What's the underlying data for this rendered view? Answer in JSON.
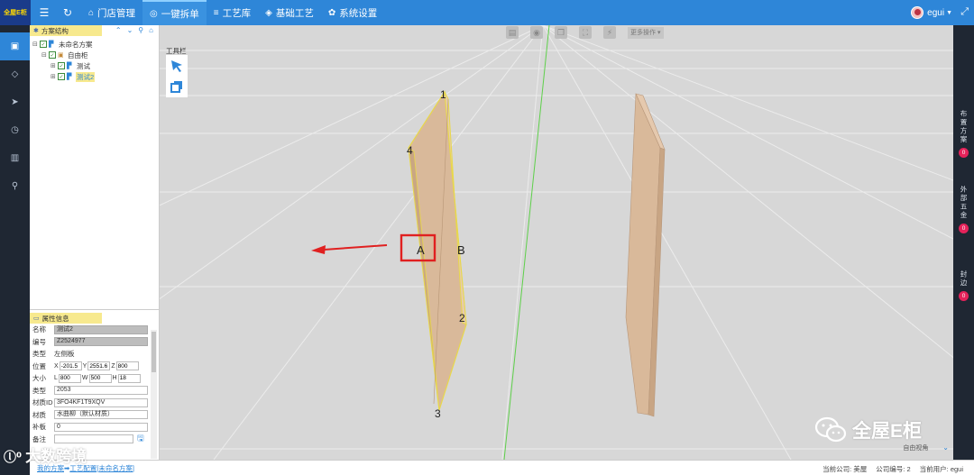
{
  "header": {
    "logo_text": "全屋E柜",
    "nav": [
      {
        "icon": "⌂",
        "label": "门店管理"
      },
      {
        "icon": "◎",
        "label": "一键拆单"
      },
      {
        "icon": "≡",
        "label": "工艺库"
      },
      {
        "icon": "◈",
        "label": "基础工艺"
      },
      {
        "icon": "✿",
        "label": "系统设置"
      }
    ],
    "active_index": 1,
    "user": "egui"
  },
  "tree": {
    "title": "方案结构",
    "nodes": [
      {
        "label": "未命名方案",
        "level": 0
      },
      {
        "label": "自由柜",
        "level": 1
      },
      {
        "label": "测试",
        "level": 2
      },
      {
        "label": "测试2",
        "level": 2,
        "selected": true
      }
    ]
  },
  "props": {
    "title": "属性信息",
    "name_label": "名称",
    "name_value": "测试2",
    "code_label": "编号",
    "code_value": "Z2524977",
    "type_label": "类型",
    "type_value": "左侧板",
    "pos_label": "位置",
    "pos_x": "-201.5",
    "pos_y": "2551.6",
    "pos_z": "800",
    "size_label": "大小",
    "size_l": "800",
    "size_w": "500",
    "size_h": "18",
    "kind_label": "类型",
    "kind_value": "2053",
    "matid_label": "材质ID",
    "matid_value": "3FO4KF1T9XQV",
    "mat_label": "材质",
    "mat_value": "水曲柳（默认材质）",
    "patch_label": "补板",
    "patch_value": "0",
    "note_label": "备注",
    "note_value": ""
  },
  "viewport": {
    "toolbox_title": "工具栏",
    "more_ops": "更多操作",
    "view_label": "自由视角",
    "vertex_labels": [
      "1",
      "2",
      "3",
      "4",
      "A",
      "B"
    ]
  },
  "right_panel": [
    {
      "label": "布置方案",
      "count": "0"
    },
    {
      "label": "外部五金",
      "count": "0"
    },
    {
      "label": "封边",
      "count": "0"
    }
  ],
  "footer": {
    "crumb_1": "我的方案",
    "crumb_sep": "➡",
    "crumb_2": "工艺配置[未命名方案]",
    "company_label": "当前公司:",
    "company": "美屋",
    "company_no_label": "公司编号:",
    "company_no": "2",
    "current_user_label": "当前用户:",
    "current_user": "egui"
  },
  "watermarks": {
    "right": "全屋E柜",
    "left": "大数跨境"
  },
  "colors": {
    "primary": "#2e86d8",
    "sidebar": "#1f2733",
    "panel_header": "#f7e98e",
    "board_fill": "#d9b99a",
    "highlight_red": "#e02020",
    "badge": "#e5225a"
  }
}
